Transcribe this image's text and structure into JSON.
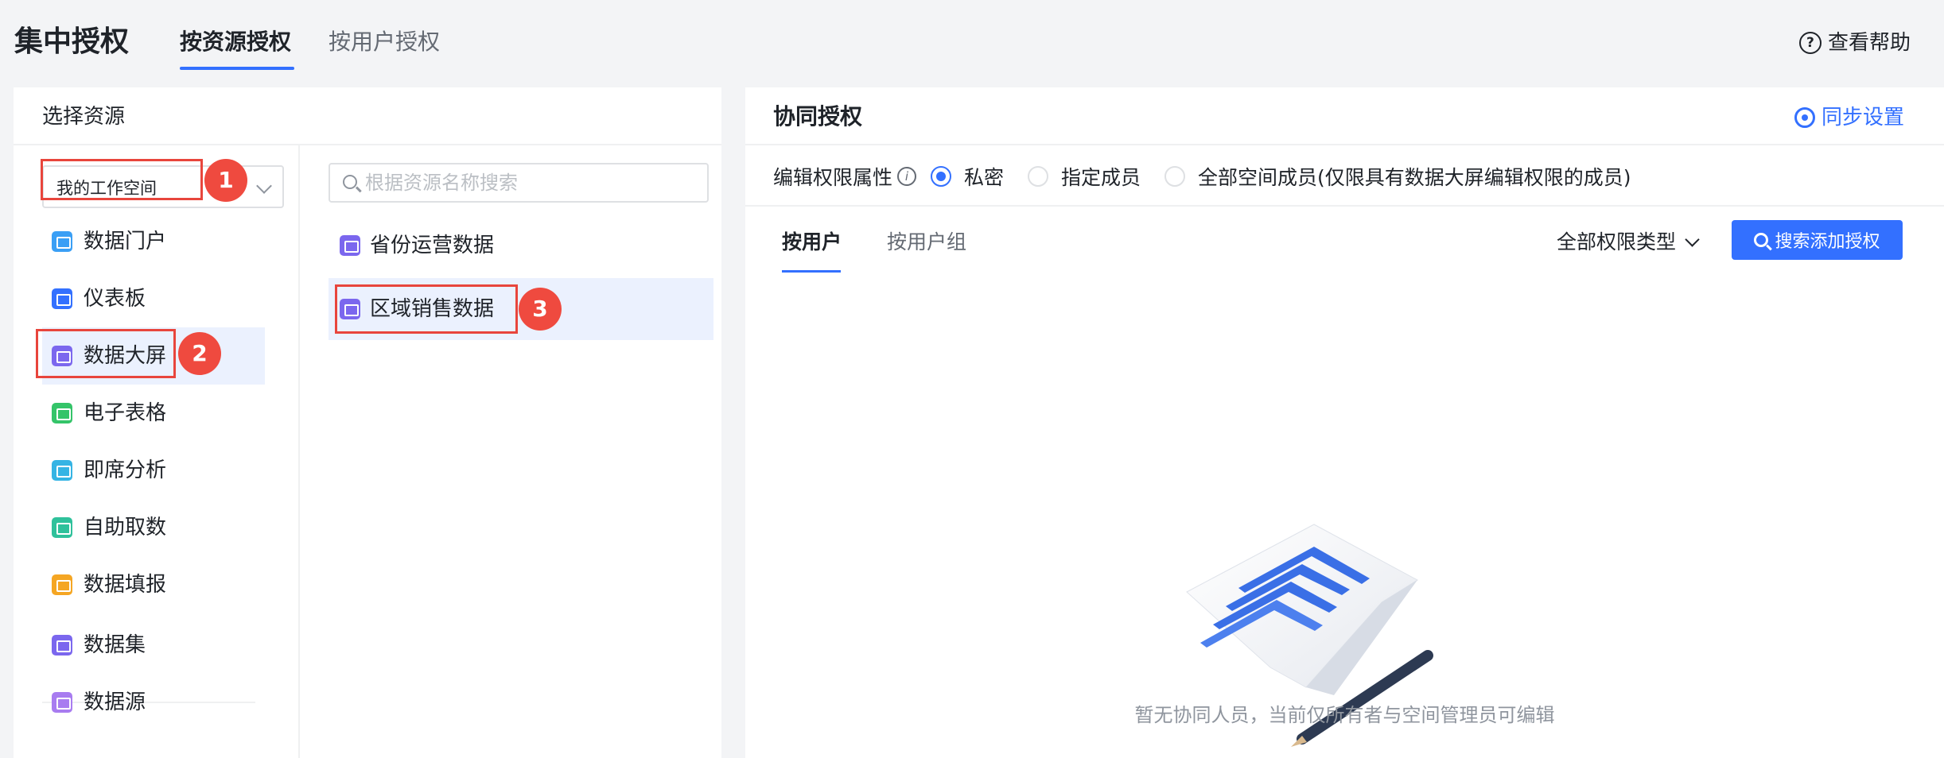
{
  "header": {
    "title": "集中授权",
    "tabs": [
      {
        "label": "按资源授权",
        "active": true
      },
      {
        "label": "按用户授权",
        "active": false
      }
    ],
    "help_label": "查看帮助",
    "help_icon": "question-circle-icon"
  },
  "left_panel": {
    "title": "选择资源",
    "workspace_select": {
      "value": "我的工作空间"
    },
    "resource_types": [
      {
        "label": "数据门户",
        "icon": "portal-icon",
        "color": "#3a9ff5"
      },
      {
        "label": "仪表板",
        "icon": "dashboard-icon",
        "color": "#3370ff"
      },
      {
        "label": "数据大屏",
        "icon": "screen-icon",
        "color": "#7b67ee",
        "selected": true
      },
      {
        "label": "电子表格",
        "icon": "spreadsheet-icon",
        "color": "#34c469"
      },
      {
        "label": "即席分析",
        "icon": "adhoc-icon",
        "color": "#35b4e4"
      },
      {
        "label": "自助取数",
        "icon": "self-service-icon",
        "color": "#2fc19b"
      },
      {
        "label": "数据填报",
        "icon": "form-icon",
        "color": "#f5a623"
      },
      {
        "label": "数据集",
        "icon": "dataset-icon",
        "color": "#7b67ee"
      },
      {
        "label": "数据源",
        "icon": "datasource-icon",
        "color": "#a87cf0"
      }
    ],
    "search": {
      "placeholder": "根据资源名称搜索"
    },
    "resources": [
      {
        "label": "省份运营数据",
        "selected": false
      },
      {
        "label": "区域销售数据",
        "selected": true
      }
    ]
  },
  "annotations": {
    "step1": "1",
    "step2": "2",
    "step3": "3",
    "color": "#e8453c"
  },
  "right_panel": {
    "title": "协同授权",
    "sync_label": "同步设置",
    "edit_permission_label": "编辑权限属性",
    "options": [
      {
        "label": "私密",
        "checked": true
      },
      {
        "label": "指定成员",
        "checked": false
      },
      {
        "label": "全部空间成员(仅限具有数据大屏编辑权限的成员)",
        "checked": false
      }
    ],
    "sub_tabs": [
      {
        "label": "按用户",
        "active": true
      },
      {
        "label": "按用户组",
        "active": false
      }
    ],
    "filter_label": "全部权限类型",
    "add_button_label": "搜索添加授权",
    "empty_text": "暂无协同人员，当前仅所有者与空间管理员可编辑"
  },
  "colors": {
    "accent": "#3370ff",
    "selected_bg": "#ebf1fe",
    "annotation_red": "#e8453c"
  }
}
